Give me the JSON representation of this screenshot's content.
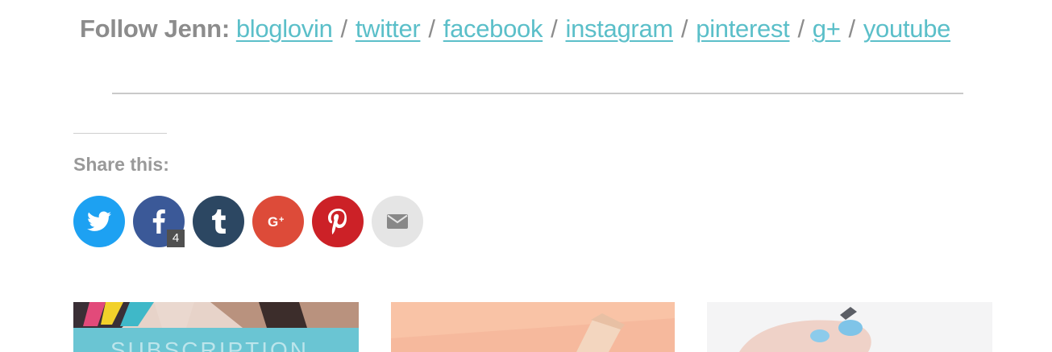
{
  "follow": {
    "label": "Follow Jenn:",
    "separator": "/",
    "links": [
      {
        "id": "bloglovin",
        "label": "bloglovin"
      },
      {
        "id": "twitter",
        "label": "twitter"
      },
      {
        "id": "facebook",
        "label": "facebook"
      },
      {
        "id": "instagram",
        "label": "instagram"
      },
      {
        "id": "pinterest",
        "label": "pinterest"
      },
      {
        "id": "gplus",
        "label": "g+"
      },
      {
        "id": "youtube",
        "label": "youtube"
      }
    ],
    "link_color": "#5bbfc9"
  },
  "share": {
    "title": "Share this:",
    "buttons": [
      {
        "id": "twitter",
        "icon": "twitter-bird-icon",
        "color": "#1da1f2"
      },
      {
        "id": "facebook",
        "icon": "facebook-f-icon",
        "color": "#3b5998",
        "count": "4"
      },
      {
        "id": "tumblr",
        "icon": "tumblr-t-icon",
        "color": "#2c4762"
      },
      {
        "id": "google-plus",
        "icon": "google-plus-icon",
        "color": "#dd4b39"
      },
      {
        "id": "pinterest",
        "icon": "pinterest-p-icon",
        "color": "#cc2127"
      },
      {
        "id": "email",
        "icon": "envelope-icon",
        "color": "#e5e5e5"
      }
    ]
  },
  "related": [
    {
      "id": "related-1",
      "overlay_text": "SUBSCRIPTION"
    },
    {
      "id": "related-2"
    },
    {
      "id": "related-3"
    }
  ]
}
